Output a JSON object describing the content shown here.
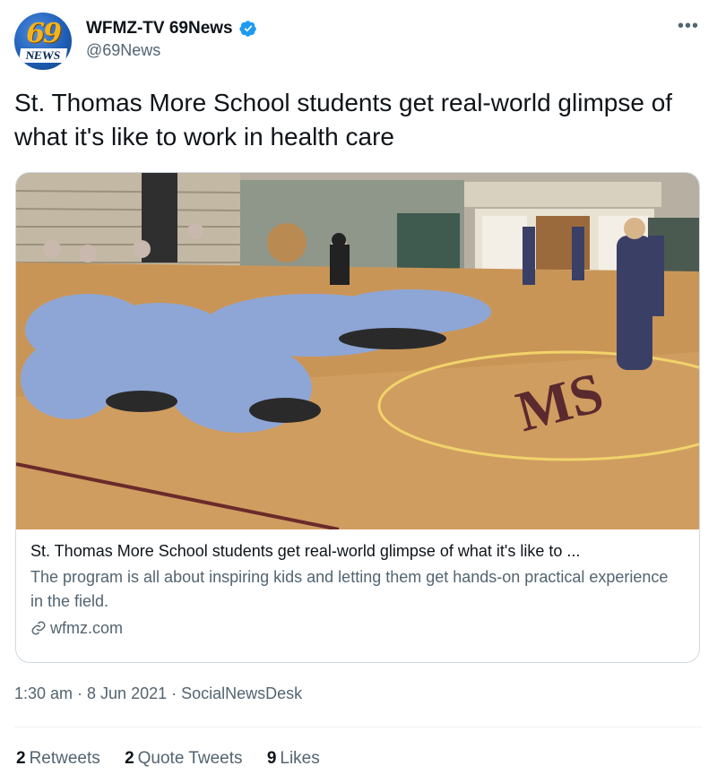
{
  "tweet": {
    "display_name": "WFMZ-TV 69News",
    "handle": "@69News",
    "avatar_text": {
      "number": "69",
      "label": "NEWS"
    },
    "text": "St. Thomas More School students get real-world glimpse of what it's like to work in health care",
    "timestamp": "1:30 am · 8 Jun 2021 · SocialNewsDesk"
  },
  "card": {
    "title": "St. Thomas More School students get real-world glimpse of what it's like to ...",
    "description": "The program is all about inspiring kids and letting them get hands-on practical experience in the field.",
    "domain": "wfmz.com",
    "court_logo_text": "MS"
  },
  "stats": {
    "retweets_count": "2",
    "retweets_label": "Retweets",
    "quotes_count": "2",
    "quotes_label": "Quote Tweets",
    "likes_count": "9",
    "likes_label": "Likes"
  },
  "colors": {
    "verified": "#1d9bf0",
    "secondary_text": "#536471",
    "border": "#cfd9de"
  },
  "icons": [
    "verified-badge-icon",
    "more-options-icon",
    "link-icon"
  ]
}
